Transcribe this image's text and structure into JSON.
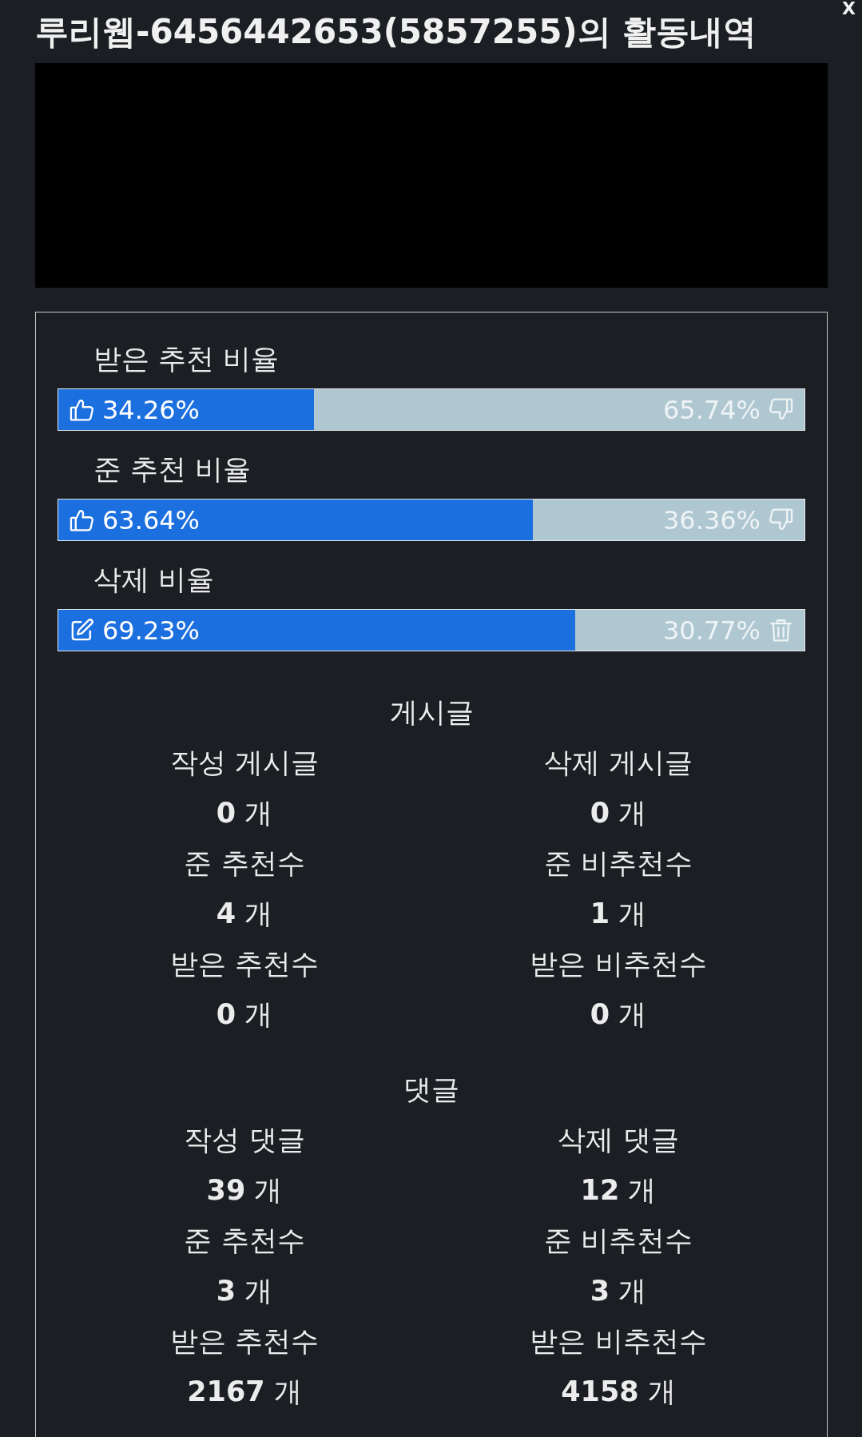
{
  "close_button": {
    "label": "X"
  },
  "title": "루리웹-6456442653(5857255)의 활동내역",
  "ratios": [
    {
      "kind": "vote",
      "label": "받은 추천 비율",
      "level": 0.3426,
      "left_value": "34.26%",
      "right_value": "65.74%"
    },
    {
      "kind": "vote",
      "label": "준 추천 비율",
      "level": 0.6364,
      "left_value": "63.64%",
      "right_value": "36.36%"
    },
    {
      "kind": "delete",
      "label": "삭제 비율",
      "level": 0.6923,
      "left_value": "69.23%",
      "right_value": "30.77%"
    }
  ],
  "sections": [
    {
      "title": "게시글",
      "stats": [
        {
          "label": "작성 게시글",
          "value": "**0** 개"
        },
        {
          "label": "삭제 게시글",
          "value": "**0** 개"
        },
        {
          "label": "준 추천수",
          "value": "**4** 개"
        },
        {
          "label": "준 비추천수",
          "value": "**1** 개"
        },
        {
          "label": "받은 추천수",
          "value": "**0** 개"
        },
        {
          "label": "받은 비추천수",
          "value": "**0** 개"
        }
      ]
    },
    {
      "title": "댓글",
      "stats": [
        {
          "label": "작성 댓글",
          "value": "**39** 개"
        },
        {
          "label": "삭제 댓글",
          "value": "**12** 개"
        },
        {
          "label": "준 추천수",
          "value": "**3** 개"
        },
        {
          "label": "준 비추천수",
          "value": "**3** 개"
        },
        {
          "label": "받은 추천수",
          "value": "**2167** 개"
        },
        {
          "label": "받은 비추천수",
          "value": "**4158** 개"
        }
      ]
    }
  ]
}
